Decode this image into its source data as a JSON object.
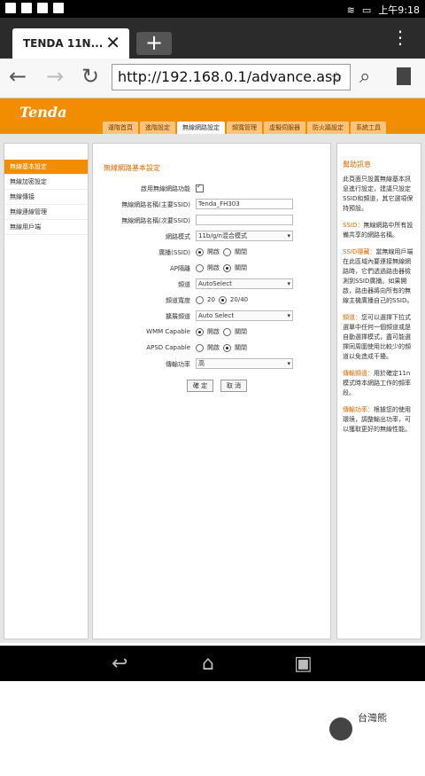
{
  "status": {
    "time": "上午9:18"
  },
  "browser": {
    "tab_title": "TENDA 11N...",
    "url": "http://192.168.0.1/advance.asp"
  },
  "router": {
    "logo": "Tenda",
    "tabs": [
      "運階首頁",
      "進階設定",
      "無線網路設定",
      "頻寬管理",
      "虛擬伺服器",
      "防火牆設定",
      "系統工具"
    ]
  },
  "sidebar": {
    "items": [
      "無線基本設定",
      "無線加密設定",
      "無線傳接",
      "無線連線管理",
      "無線用戶端"
    ]
  },
  "main": {
    "title": "無線網路基本設定",
    "rows": [
      {
        "label": "啟用無線網路功能"
      },
      {
        "label": "無線網路名稱(主要SSID)",
        "value": "Tenda_FH303"
      },
      {
        "label": "無線網路名稱(次要SSID)",
        "value": ""
      },
      {
        "label": "網路模式",
        "value": "11b/g/n混合模式"
      },
      {
        "label": "廣播(SSID)",
        "opt1": "開啟",
        "opt2": "關閉"
      },
      {
        "label": "AP隔離",
        "opt1": "開啟",
        "opt2": "關閉"
      },
      {
        "label": "頻道",
        "value": "AutoSelect"
      },
      {
        "label": "頻道寬度",
        "opt1": "20",
        "opt2": "20/40"
      },
      {
        "label": "擴展頻道",
        "value": "Auto Select"
      },
      {
        "label": "WMM Capable",
        "opt1": "開啟",
        "opt2": "關閉"
      },
      {
        "label": "APSD Capable",
        "opt1": "開啟",
        "opt2": "關閉"
      },
      {
        "label": "傳輸功率",
        "value": "高"
      }
    ],
    "ok": "確 定",
    "cancel": "取 消"
  },
  "help": {
    "title": "幫助訊息",
    "intro": "此頁面只設置無線基本訊息進行設定，建議只設定SSID和頻道，其它選項保持預設。",
    "items": [
      {
        "k": "SSID：",
        "v": "無線網路中所有設備共享的網路名稱。"
      },
      {
        "k": "SSID隱藏：",
        "v": "當無線用戶端在此區域內要連接無線網路時，它們透過路由器檢測到SSID廣播。如果開啟，路由器將向所有的無線主機廣播自己的SSID。"
      },
      {
        "k": "頻道：",
        "v": "您可以選擇下拉式選單中任何一個頻道或是自動選擇模式，盡可能選擇同周圍使用比較少的頻道以免造成干擾。"
      },
      {
        "k": "傳輸頻道：",
        "v": "用於確定11n模式時本網路工作的頻率段。"
      },
      {
        "k": "傳輸功率：",
        "v": "根據您的使用環境，調整輸出功率，可以獲取更好的無線性能。"
      }
    ]
  },
  "watermark": {
    "text": "台灣熊"
  }
}
